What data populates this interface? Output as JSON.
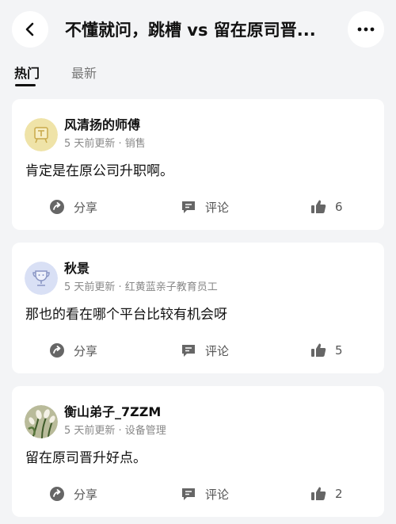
{
  "header": {
    "title": "不懂就问，跳槽 vs 留在原司晋..."
  },
  "tabs": [
    {
      "label": "热门",
      "active": true
    },
    {
      "label": "最新",
      "active": false
    }
  ],
  "posts": [
    {
      "username": "风清扬的师傅",
      "meta": "5 天前更新 · 销售",
      "content": "肯定是在原公司升职啊。",
      "share_label": "分享",
      "comment_label": "评论",
      "likes": "6",
      "avatar_icon": "scroll-badge-icon"
    },
    {
      "username": "秋景",
      "meta": "5 天前更新 · 红黄蓝亲子教育员工",
      "content": "那也的看在哪个平台比较有机会呀",
      "share_label": "分享",
      "comment_label": "评论",
      "likes": "5",
      "avatar_icon": "trophy-icon"
    },
    {
      "username": "衡山弟子_7ZZM",
      "meta": "5 天前更新 · 设备管理",
      "content": "留在原司晋升好点。",
      "share_label": "分享",
      "comment_label": "评论",
      "likes": "2",
      "avatar_icon": "flower-photo"
    }
  ],
  "colors": {
    "background": "#f3f4f6",
    "card": "#ffffff",
    "text": "#111111",
    "meta": "#888888"
  }
}
